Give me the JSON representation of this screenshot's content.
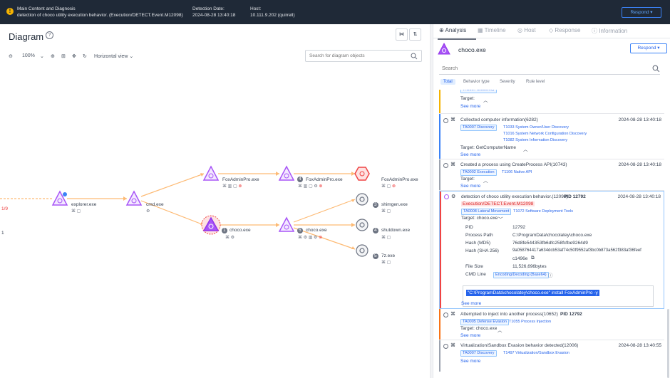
{
  "header": {
    "line1": "Main Content and Diagnosis",
    "line2": "detection of choco utility execution behavior. (Execution/DETECT.Event.M12098)",
    "date_label": "Detection Date:",
    "date_value": "2024-08-28 13:40:18",
    "host_label": "Host:",
    "host_value": "10.111.9.202 (quirrell)",
    "respond": "Respond"
  },
  "diagram": {
    "title": "Diagram",
    "zoom": "100%",
    "view": "Horizontal view",
    "search_placeholder": "Search for diagram objects",
    "edge_text": "1/9",
    "edge_text2": "1",
    "nodes": [
      {
        "label": "explorer.exe",
        "num": ""
      },
      {
        "label": "cmd.exe",
        "num": ""
      },
      {
        "label": "choco.exe",
        "num": "1"
      },
      {
        "label": "FoxAdminPro.exe",
        "num": ""
      },
      {
        "label": "FoxAdminPro.exe",
        "num": "4"
      },
      {
        "label": "FoxAdminPro.exe",
        "num": ""
      },
      {
        "label": "choco.exe",
        "num": "5"
      },
      {
        "label": "shimgen.exe",
        "num": "3"
      },
      {
        "label": "shutdown.exe",
        "num": "4"
      },
      {
        "label": "7z.exe",
        "num": "5"
      }
    ]
  },
  "panel": {
    "tabs": [
      "Analysis",
      "Timeline",
      "Host",
      "Response",
      "Information"
    ],
    "process": "choco.exe",
    "respond": "Respond",
    "search_placeholder": "Search",
    "filters": [
      "Total",
      "Behavior type",
      "Severity",
      "Rule level"
    ],
    "events": [
      {
        "title": "",
        "target": "Target:",
        "more": "See more"
      },
      {
        "title": "Collected computer information(6282)",
        "time": "2024-08-28 13:40:18",
        "tag": "TA0007 Discovery",
        "techs": [
          "T1033 System Owner/User Discovery",
          "T1016 System Network Configuration Discovery",
          "T1082 System Information Discovery"
        ],
        "target": "Target: GetComputerName",
        "more": "See more"
      },
      {
        "title": "Created a process using CreateProcess API(10743)",
        "time": "2024-08-28 13:40:18",
        "tag": "TA0002 Execution",
        "techs": [
          "T1106 Native API"
        ],
        "target": "Target:",
        "more": "See more"
      },
      {
        "title": "detection of choco utility execution behavior.(12098)",
        "pid_label": "PID 12792",
        "time": "2024-08-28 13:40:18",
        "event": "Execution/DETECT.Event.M12098",
        "tag": "TA0008 Lateral Movement",
        "techs": [
          "T1072 Software Deployment Tools"
        ],
        "target": "Target: choco.exe",
        "details": [
          {
            "k": "PID",
            "v": "12792"
          },
          {
            "k": "Process Path",
            "v": "C:\\ProgramData\\chocolatey\\choco.exe"
          },
          {
            "k": "Hash (MD5)",
            "v": "76d8fe544353fb6dfc258fcfbe9264d9"
          },
          {
            "k": "Hash (SHA 256)",
            "v": "9a058764417a634dcb53af74c50f9552af3bc0b873a562f383af36feef"
          },
          {
            "k": "",
            "v": "c1496e"
          },
          {
            "k": "File Size",
            "v": "11,526,696bytes"
          },
          {
            "k": "CMD Line",
            "v": "Encoding/Decoding (Base64)"
          }
        ],
        "cmdline": "\"C:\\ProgramData\\chocolatey\\choco.exe\" install FoxAdminPro -y",
        "more": "See more"
      },
      {
        "title": "Attempted to inject into another process(10652)",
        "pid_label": "PID 12792",
        "tag": "TA0005 Defense Evasion",
        "techs": [
          "T1055 Process Injection"
        ],
        "target": "Target: choco.exe",
        "more": "See more"
      },
      {
        "title": "Virtualization/Sandbox Evasion behavior detected(12006)",
        "time": "2024-08-28 13:40:55",
        "tag": "TA0007 Discovery",
        "techs": [
          "T1497 Virtualization/Sandbox Evasion"
        ],
        "more": "See more"
      }
    ]
  },
  "colors": {
    "accent": "#2563eb",
    "node": "#a855f7",
    "alert": "#dc2626",
    "edge": "#fdba74"
  }
}
